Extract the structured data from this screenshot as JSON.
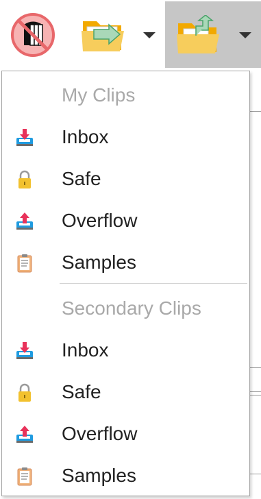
{
  "toolbar": {
    "buttons": [
      {
        "icon": "no-clipboard-icon"
      },
      {
        "icon": "folder-move-icon",
        "has_dropdown": true
      },
      {
        "icon": "folder-export-icon",
        "has_dropdown": true,
        "pressed": true
      }
    ]
  },
  "menu": {
    "sections": [
      {
        "header": "My Clips",
        "items": [
          {
            "label": "Inbox",
            "icon": "inbox-in-icon"
          },
          {
            "label": "Safe",
            "icon": "lock-icon"
          },
          {
            "label": "Overflow",
            "icon": "inbox-out-icon"
          },
          {
            "label": "Samples",
            "icon": "clipboard-icon"
          }
        ]
      },
      {
        "header": "Secondary Clips",
        "items": [
          {
            "label": "Inbox",
            "icon": "inbox-in-icon"
          },
          {
            "label": "Safe",
            "icon": "lock-icon"
          },
          {
            "label": "Overflow",
            "icon": "inbox-out-icon"
          },
          {
            "label": "Samples",
            "icon": "clipboard-icon"
          }
        ]
      }
    ]
  },
  "colors": {
    "header_text": "#a9a9a9",
    "item_text": "#222222",
    "pressed_button": "#c6c6c6",
    "menu_border": "#a5a5a5",
    "inbox_arrow": "#e8325a",
    "overflow_arrow": "#e8325a",
    "tray_blue": "#1f9be0",
    "folder_yellow": "#f5c542",
    "lock_gold": "#f2c12e"
  }
}
